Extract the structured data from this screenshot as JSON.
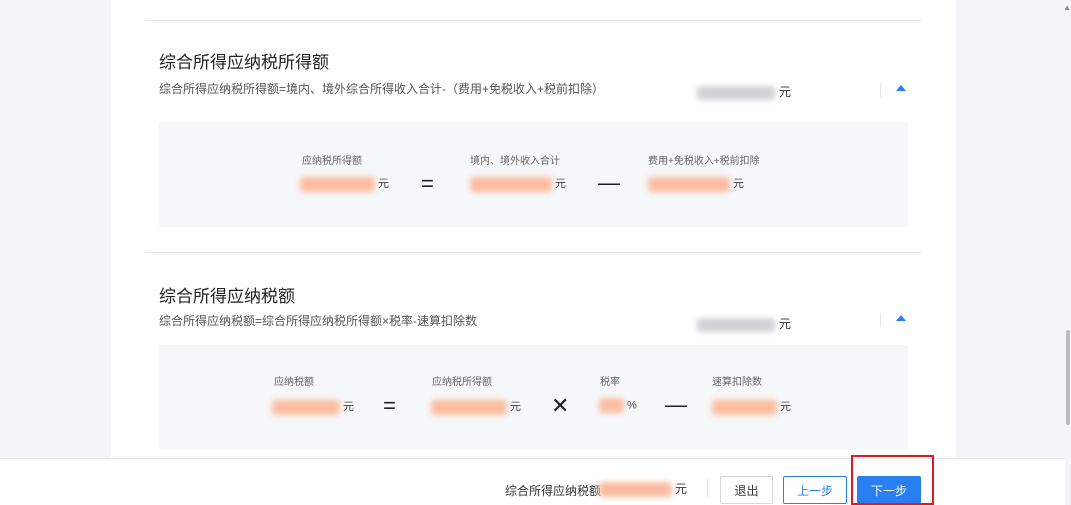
{
  "section1": {
    "title": "综合所得应纳税所得额",
    "formula": "综合所得应纳税所得额=境内、境外综合所得收入合计-（费用+免税收入+税前扣除）",
    "unit": "元",
    "calc": {
      "labels": [
        "应纳税所得额",
        "境内、境外收入合计",
        "费用+免税收入+税前扣除"
      ],
      "units": [
        "元",
        "元",
        "元"
      ],
      "ops": [
        "=",
        "—"
      ]
    }
  },
  "section2": {
    "title": "综合所得应纳税额",
    "formula": "综合所得应纳税额=综合所得应纳税所得额×税率-速算扣除数",
    "unit": "元",
    "calc": {
      "labels": [
        "应纳税额",
        "应纳税所得额",
        "税率",
        "速算扣除数"
      ],
      "units": [
        "元",
        "元",
        "%",
        "元"
      ],
      "ops": [
        "=",
        "✕",
        "—"
      ]
    }
  },
  "footer": {
    "label": "综合所得应纳税额",
    "unit": "元",
    "exit_label": "退出",
    "prev_label": "上一步",
    "next_label": "下一步"
  },
  "icons": {
    "collapse": "caret-up-icon",
    "scroll_up": "scroll-up-arrow-icon"
  },
  "colors": {
    "primary": "#2a7ff0",
    "highlight": "#e0191e",
    "amount_blur": "#fcbca0"
  }
}
